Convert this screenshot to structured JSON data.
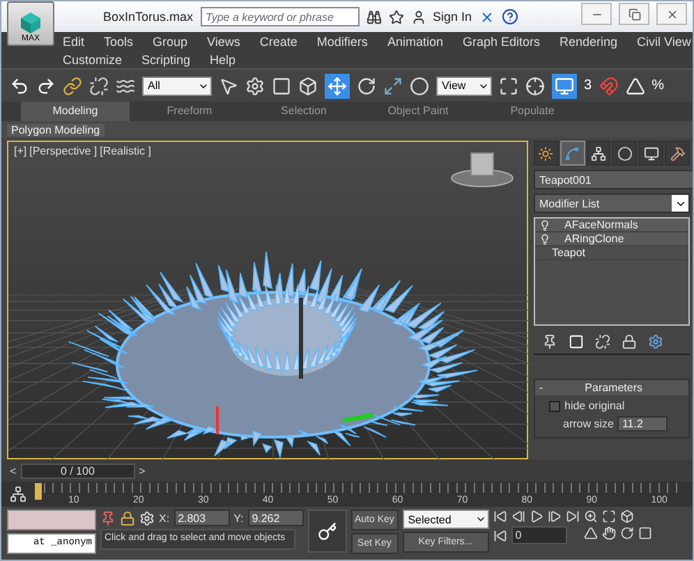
{
  "title_bar": {
    "app_button": "MAX",
    "title": "BoxInTorus.max",
    "search": {
      "placeholder": "Type a keyword or phrase"
    },
    "sign_in": "Sign In"
  },
  "menu_rows": [
    [
      "Edit",
      "Tools",
      "Group",
      "Views",
      "Create",
      "Modifiers",
      "Animation",
      "Graph Editors",
      "Rendering",
      "Civil View"
    ],
    [
      "Customize",
      "Scripting",
      "Help"
    ]
  ],
  "toolbar": {
    "selection_filter": "All",
    "reference_coord": "View",
    "snap_label": "3",
    "percent_label": "%"
  },
  "ribbon": {
    "tabs": [
      {
        "label": "Modeling",
        "selected": true
      },
      {
        "label": "Freeform",
        "selected": false
      },
      {
        "label": "Selection",
        "selected": false
      },
      {
        "label": "Object Paint",
        "selected": false
      },
      {
        "label": "Populate",
        "selected": false
      }
    ],
    "panel": "Polygon Modeling"
  },
  "viewport": {
    "labels": [
      "[+]",
      "[Perspective ]",
      "[Realistic ]"
    ],
    "active": true
  },
  "command_panel": {
    "tabs": [
      {
        "kind": "create",
        "selected": false
      },
      {
        "kind": "modify",
        "selected": true
      },
      {
        "kind": "hierarchy",
        "selected": false
      },
      {
        "kind": "motion",
        "selected": false
      },
      {
        "kind": "display",
        "selected": false
      },
      {
        "kind": "utilities",
        "selected": false
      }
    ],
    "object_name": "Teapot001",
    "modifier_list": "Modifier List",
    "stack": [
      {
        "kind": "modifier",
        "label": "AFaceNormals",
        "on": true
      },
      {
        "kind": "modifier",
        "label": "ARingClone",
        "on": true
      },
      {
        "kind": "base",
        "label": "Teapot"
      }
    ],
    "rollout": {
      "collapse": "-",
      "title": "Parameters",
      "hide_original": {
        "label": "hide original",
        "checked": false
      },
      "arrow_size": {
        "label": "arrow size",
        "value": "11.2"
      }
    }
  },
  "time_slider": {
    "prev": "<",
    "position": "0 / 100",
    "next": ">"
  },
  "track_bar": {
    "ticks": [
      "10",
      "20",
      "30",
      "40",
      "50",
      "60",
      "70",
      "80",
      "90",
      "100"
    ]
  },
  "status": {
    "script_output": "at _anonym",
    "x_label": "X:",
    "x_value": "2.803",
    "y_label": "Y:",
    "y_value": "9.262",
    "prompt": "Click and drag to select and move objects",
    "auto_key": "Auto Key",
    "key_mode": "Selected",
    "set_key": "Set Key",
    "key_filters": "Key Filters...",
    "frame": "0"
  }
}
